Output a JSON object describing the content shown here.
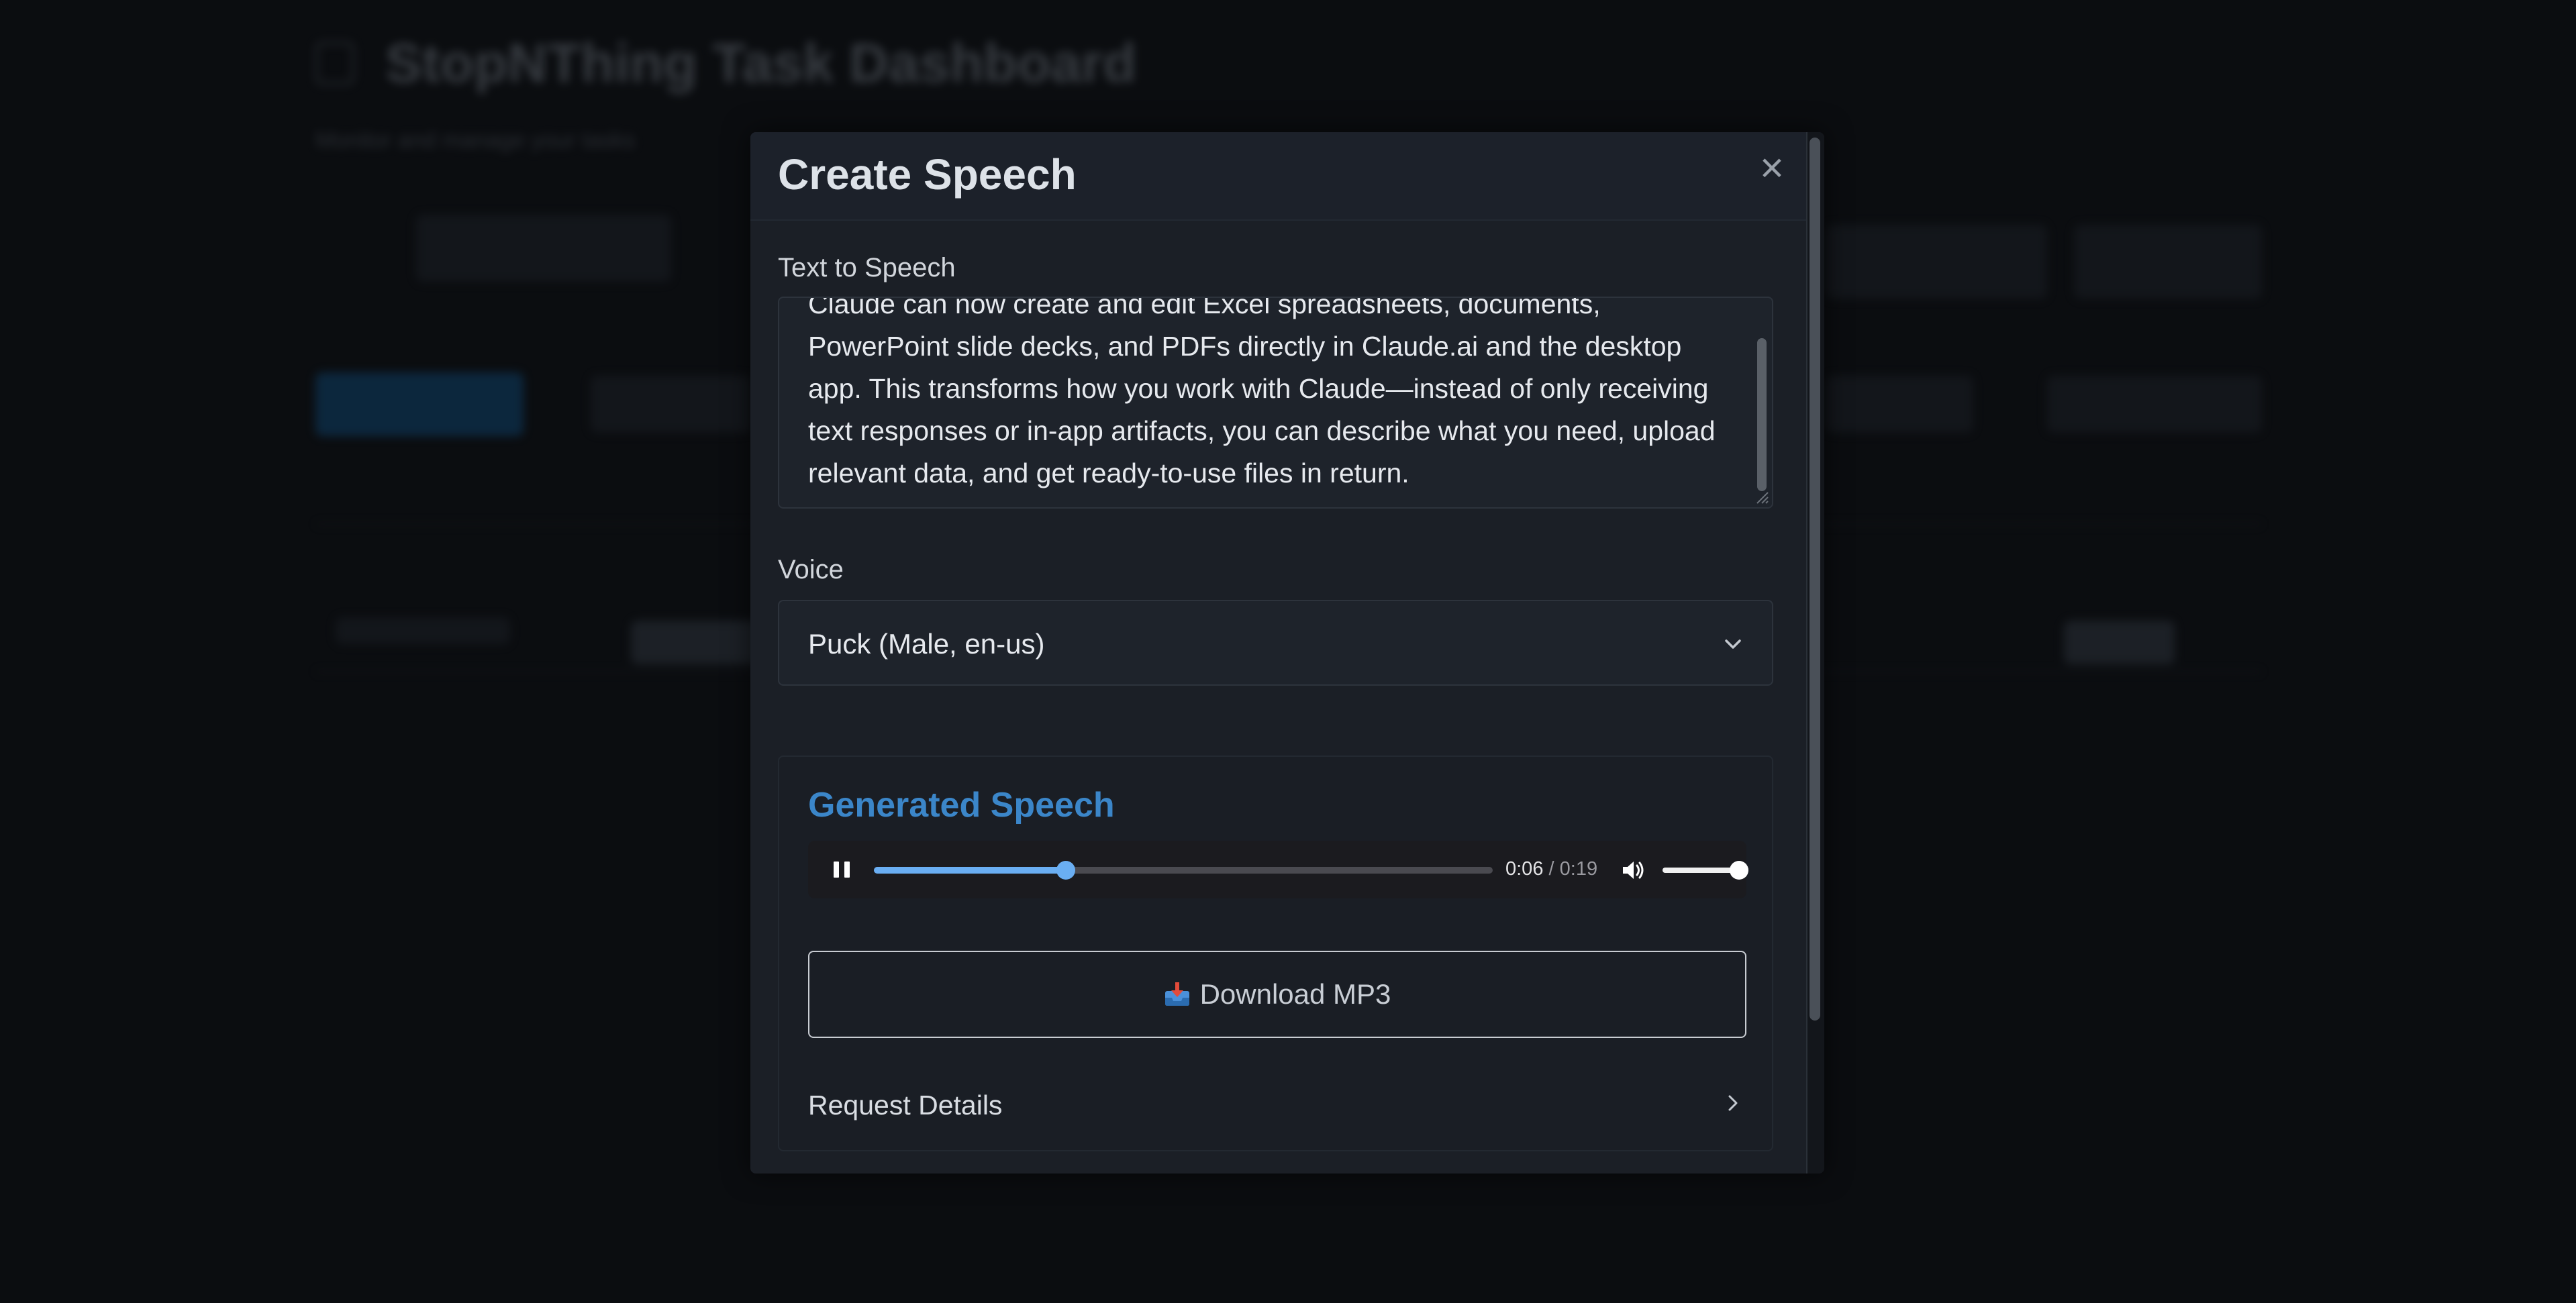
{
  "background": {
    "title": "StopNThing Task Dashboard",
    "subtitle": "Monitor and manage your tasks"
  },
  "modal": {
    "title": "Create Speech",
    "close_symbol": "×",
    "text_label": "Text to Speech",
    "text_value": "Claude can now create and edit Excel spreadsheets, documents, PowerPoint slide decks, and PDFs directly in Claude.ai and the desktop app. This transforms how you work with Claude—instead of only receiving text responses or in-app artifacts, you can describe what you need, upload relevant data, and get ready-to-use files in return.",
    "voice_label": "Voice",
    "voice_selected": "Puck (Male, en-us)",
    "generated": {
      "title": "Generated Speech",
      "audio": {
        "current_time": "0:06",
        "separator": "/",
        "duration": "0:19",
        "progress_fraction": 0.31,
        "volume_fraction": 1.0,
        "state": "playing"
      },
      "download_label": "Download MP3",
      "download_icon": "inbox-tray-icon",
      "details_label": "Request Details"
    }
  },
  "colors": {
    "accent": "#3b86c9",
    "progress": "#6aaef2",
    "modal_bg": "#1b1f26",
    "page_bg": "#0b0d10"
  }
}
